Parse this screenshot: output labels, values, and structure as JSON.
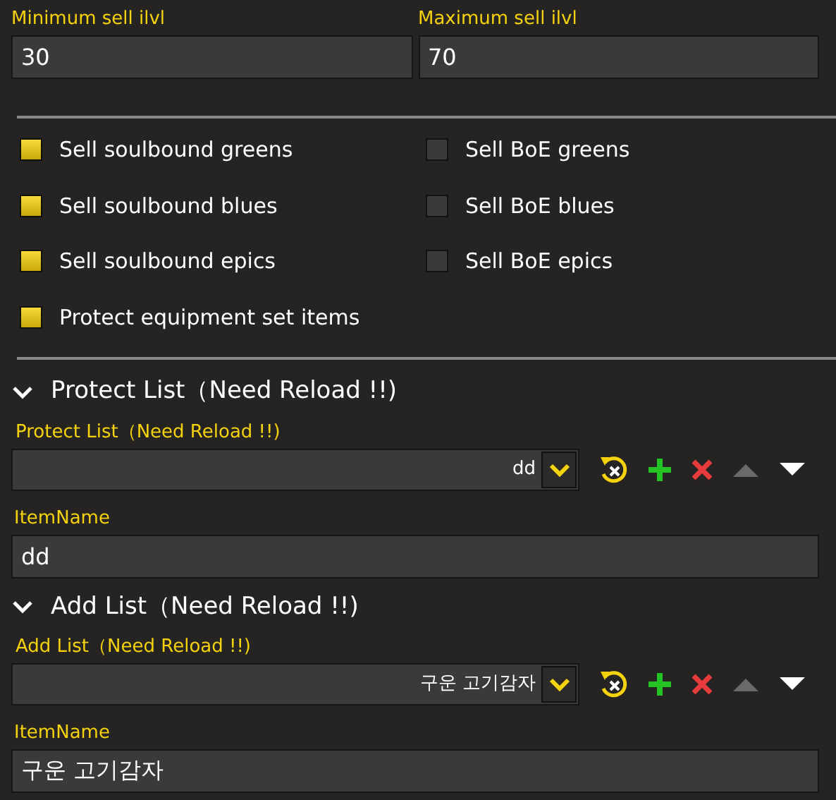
{
  "ilvl_fields": [
    {
      "label": "Minimum sell ilvl",
      "value": "30"
    },
    {
      "label": "Maximum sell ilvl",
      "value": "70"
    }
  ],
  "options": [
    {
      "label": "Sell soulbound greens",
      "checked": true
    },
    {
      "label": "Sell BoE greens",
      "checked": false
    },
    {
      "label": "Sell soulbound blues",
      "checked": true
    },
    {
      "label": "Sell BoE blues",
      "checked": false
    },
    {
      "label": "Sell soulbound epics",
      "checked": true
    },
    {
      "label": "Sell BoE epics",
      "checked": false
    },
    {
      "label": "Protect equipment set items",
      "checked": true
    }
  ],
  "lists": [
    {
      "title": "Protect List（Need Reload !!)",
      "expanded": true,
      "dropdown_label": "Protect List（Need Reload !!)",
      "dropdown_value": "dd",
      "move_up_disabled": true,
      "move_down_disabled": false,
      "item_label": "ItemName",
      "item_value": "dd"
    },
    {
      "title": "Add List（Need Reload !!)",
      "expanded": true,
      "dropdown_label": "Add List（Need Reload !!)",
      "dropdown_value": "구운 고기감자",
      "move_up_disabled": true,
      "move_down_disabled": false,
      "item_label": "ItemName",
      "item_value": "구운 고기감자"
    }
  ]
}
